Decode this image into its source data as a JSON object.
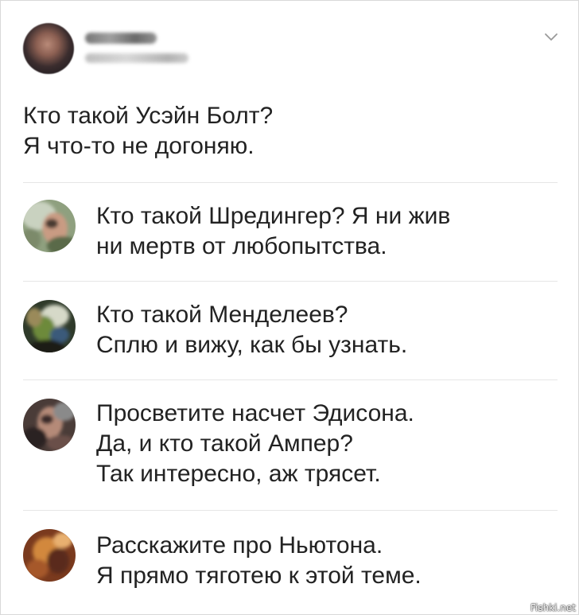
{
  "post": {
    "text_lines": [
      "Кто такой Усэйн Болт?",
      "Я что-то не догоняю."
    ],
    "menu_icon": "chevron-down-icon"
  },
  "replies": [
    {
      "lines": [
        "Кто такой Шредингер? Я ни жив",
        "ни мертв от любопытства."
      ]
    },
    {
      "lines": [
        "Кто такой Менделеев?",
        "Сплю и вижу, как бы узнать."
      ]
    },
    {
      "lines": [
        "Просветите насчет Эдисона.",
        "Да, и кто такой Ампер?",
        "Так интересно, аж трясет."
      ]
    },
    {
      "lines": [
        "Расскажите про Ньютона.",
        "Я прямо тяготею к этой теме."
      ]
    }
  ],
  "watermark": "Fishki.net"
}
